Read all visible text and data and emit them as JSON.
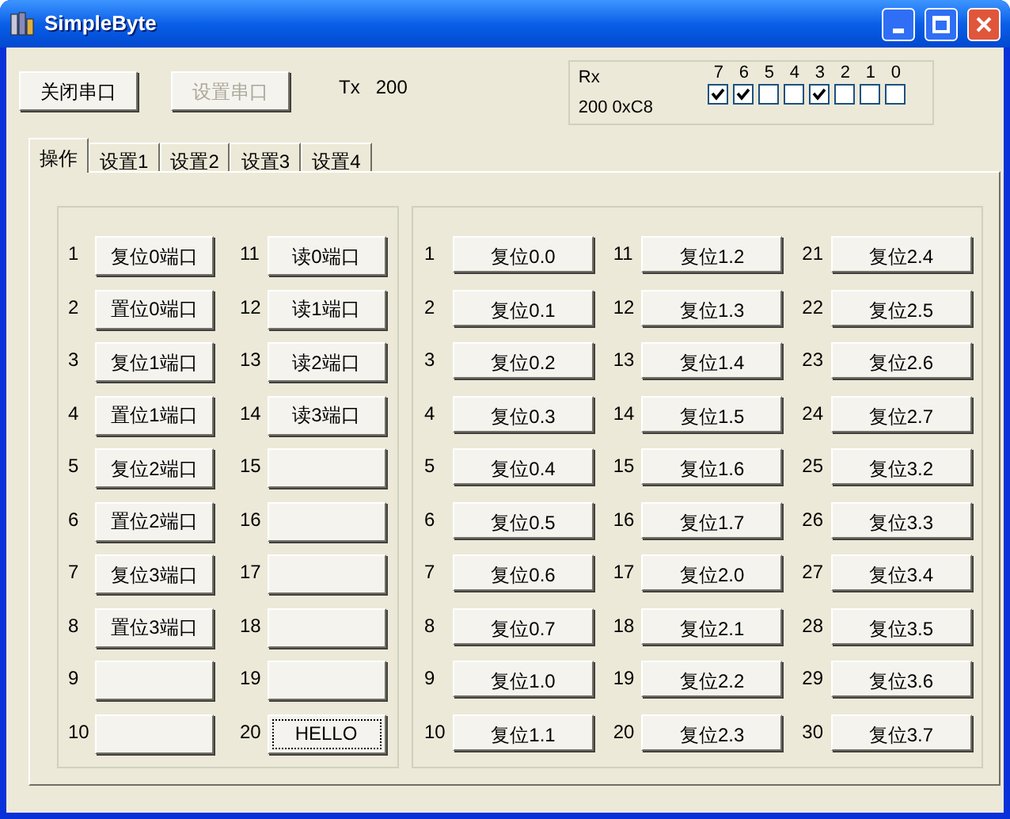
{
  "window": {
    "title": "SimpleByte"
  },
  "toolbar": {
    "buttons": [
      {
        "label": "关闭串口",
        "disabled": false
      },
      {
        "label": "设置串口",
        "disabled": true
      }
    ],
    "tx_label": "Tx",
    "tx_value": "200"
  },
  "rx": {
    "label": "Rx",
    "value": "200 0xC8",
    "bits": [
      {
        "label": "7",
        "checked": true
      },
      {
        "label": "6",
        "checked": true
      },
      {
        "label": "5",
        "checked": false
      },
      {
        "label": "4",
        "checked": false
      },
      {
        "label": "3",
        "checked": true
      },
      {
        "label": "2",
        "checked": false
      },
      {
        "label": "1",
        "checked": false
      },
      {
        "label": "0",
        "checked": false
      }
    ]
  },
  "tabs": [
    {
      "label": "操作",
      "selected": true
    },
    {
      "label": "设置1",
      "selected": false
    },
    {
      "label": "设置2",
      "selected": false
    },
    {
      "label": "设置3",
      "selected": false
    },
    {
      "label": "设置4",
      "selected": false
    }
  ],
  "left_panel": {
    "items": [
      {
        "number": "1",
        "label": "复位0端口",
        "focused": false
      },
      {
        "number": "2",
        "label": "置位0端口",
        "focused": false
      },
      {
        "number": "3",
        "label": "复位1端口",
        "focused": false
      },
      {
        "number": "4",
        "label": "置位1端口",
        "focused": false
      },
      {
        "number": "5",
        "label": "复位2端口",
        "focused": false
      },
      {
        "number": "6",
        "label": "置位2端口",
        "focused": false
      },
      {
        "number": "7",
        "label": "复位3端口",
        "focused": false
      },
      {
        "number": "8",
        "label": "置位3端口",
        "focused": false
      },
      {
        "number": "9",
        "focused": false
      },
      {
        "number": "10",
        "focused": false
      },
      {
        "number": "11",
        "label": "读0端口",
        "focused": false
      },
      {
        "number": "12",
        "label": "读1端口",
        "focused": false
      },
      {
        "number": "13",
        "label": "读2端口",
        "focused": false
      },
      {
        "number": "14",
        "label": "读3端口",
        "focused": false
      },
      {
        "number": "15",
        "focused": false
      },
      {
        "number": "16",
        "focused": false
      },
      {
        "number": "17",
        "focused": false
      },
      {
        "number": "18",
        "focused": false
      },
      {
        "number": "19",
        "focused": false
      },
      {
        "number": "20",
        "label": "HELLO",
        "focused": true
      }
    ]
  },
  "right_panel": {
    "items": [
      {
        "number": "1",
        "label": "复位0.0"
      },
      {
        "number": "2",
        "label": "复位0.1"
      },
      {
        "number": "3",
        "label": "复位0.2"
      },
      {
        "number": "4",
        "label": "复位0.3"
      },
      {
        "number": "5",
        "label": "复位0.4"
      },
      {
        "number": "6",
        "label": "复位0.5"
      },
      {
        "number": "7",
        "label": "复位0.6"
      },
      {
        "number": "8",
        "label": "复位0.7"
      },
      {
        "number": "9",
        "label": "复位1.0"
      },
      {
        "number": "10",
        "label": "复位1.1"
      },
      {
        "number": "11",
        "label": "复位1.2"
      },
      {
        "number": "12",
        "label": "复位1.3"
      },
      {
        "number": "13",
        "label": "复位1.4"
      },
      {
        "number": "14",
        "label": "复位1.5"
      },
      {
        "number": "15",
        "label": "复位1.6"
      },
      {
        "number": "16",
        "label": "复位1.7"
      },
      {
        "number": "17",
        "label": "复位2.0"
      },
      {
        "number": "18",
        "label": "复位2.1"
      },
      {
        "number": "19",
        "label": "复位2.2"
      },
      {
        "number": "20",
        "label": "复位2.3"
      },
      {
        "number": "21",
        "label": "复位2.4"
      },
      {
        "number": "22",
        "label": "复位2.5"
      },
      {
        "number": "23",
        "label": "复位2.6"
      },
      {
        "number": "24",
        "label": "复位2.7"
      },
      {
        "number": "25",
        "label": "复位3.2"
      },
      {
        "number": "26",
        "label": "复位3.3"
      },
      {
        "number": "27",
        "label": "复位3.4"
      },
      {
        "number": "28",
        "label": "复位3.5"
      },
      {
        "number": "29",
        "label": "复位3.6"
      },
      {
        "number": "30",
        "label": "复位3.7"
      }
    ]
  }
}
